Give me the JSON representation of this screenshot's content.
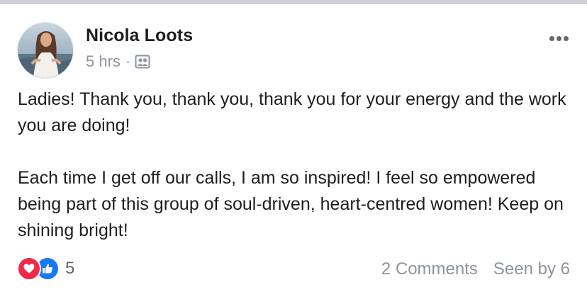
{
  "post": {
    "author": {
      "name": "Nicola Loots",
      "avatar_icon": "profile-photo"
    },
    "timestamp": "5 hrs",
    "separator": "·",
    "audience_icon": "group-icon",
    "more_icon": "more-options-icon",
    "paragraphs": [
      "Ladies! Thank you, thank you, thank you for your energy and the work you are doing!",
      "Each time I get off our calls, I am so inspired! I feel so empowered being part of this group of soul-driven, heart-centred women! Keep on shining bright!"
    ],
    "reactions": {
      "types": [
        "love-icon",
        "like-icon"
      ],
      "count": "5"
    },
    "comments": "2 Comments",
    "seen_by": "Seen by 6"
  },
  "colors": {
    "love": "#f0284a",
    "like": "#1877f2",
    "secondary_text": "#8d949e",
    "primary_text": "#1c1e21"
  }
}
